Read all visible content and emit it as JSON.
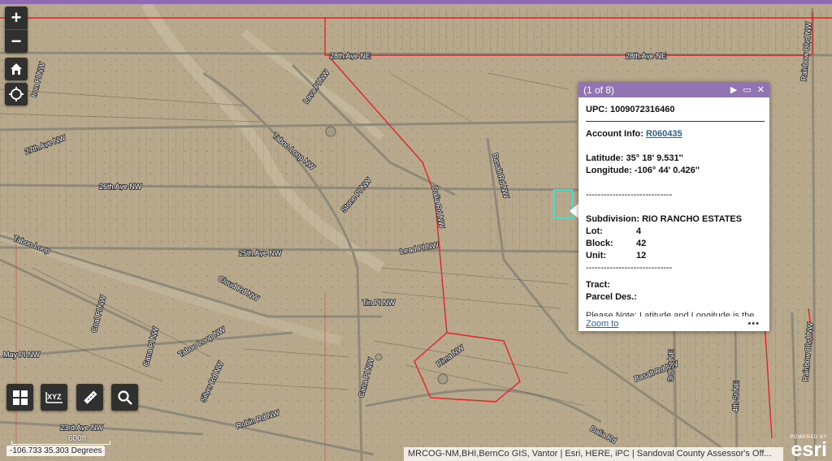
{
  "colors": {
    "popup_header": "#9274b4",
    "parcel_highlight": "#39e6d6",
    "boundary": "#e0232a",
    "map_ground": "#b9a98c"
  },
  "zoom": {
    "in": "+",
    "out": "−"
  },
  "controls": {
    "home": "home-icon",
    "locate": "locate-icon"
  },
  "tools": [
    "grid-icon",
    "xyz-icon",
    "ruler-icon",
    "search-icon"
  ],
  "tool_labels": {
    "xyz": "XYZ"
  },
  "streets": [
    "28th Ave NE",
    "28th Ave NE",
    "Rainbow Blvd NW",
    "Iron Pl NW",
    "Lava Pl NW",
    "27th Ave NW",
    "Taboo Loop NW",
    "26th Ave NW",
    "Stone Pl NW",
    "Dalia Rd NW",
    "Basalt Rd NW",
    "Taboo Loop",
    "25th Ave NW",
    "Lead Pl NW",
    "Cloud Rd NW",
    "Tin Pl NW",
    "Coal Pl NW",
    "Cana Pl NW",
    "Taboo Loop NW",
    "May Pl NW",
    "Silver Rd NW",
    "Cana Pl NW",
    "Rima NW",
    "Basalt Rd NW",
    "3rd St NE",
    "4th St NE",
    "Rainbow Blvd NW",
    "Robin Rd NW",
    "23rd Ave NW",
    "Dalia Rd"
  ],
  "popup": {
    "count": "(1 of 8)",
    "upc_label": "UPC:",
    "upc_value": "1009072316460",
    "account_label": "Account Info:",
    "account_value": "R060435",
    "lat_label": "Latitude:",
    "lat_value": "35° 18' 9.531''",
    "lon_label": "Longitude:",
    "lon_value": "-106° 44' 0.426''",
    "divider": "-----------------------------",
    "subdivision_label": "Subdivision:",
    "subdivision_value": "RIO RANCHO ESTATES",
    "lot_label": "Lot:",
    "lot_value": "4",
    "block_label": "Block:",
    "block_value": "42",
    "unit_label": "Unit:",
    "unit_value": "12",
    "tract_label": "Tract:",
    "parcel_label": "Parcel Des.:",
    "note": "Please Note: Latitude and Longitude is the approximate center of the parcel shown.",
    "zoom_to": "Zoom to",
    "more": "•••"
  },
  "scale": {
    "label": "600ft"
  },
  "coordinates": {
    "text": "-106.733 35.303 Degrees"
  },
  "attribution": {
    "text": "MRCOG-NM,BHI,BernCo GIS, Vantor | Esri, HERE, iPC | Sandoval County Assessor's Off..."
  },
  "esri": {
    "powered_by": "POWERED BY",
    "logo": "esri"
  }
}
